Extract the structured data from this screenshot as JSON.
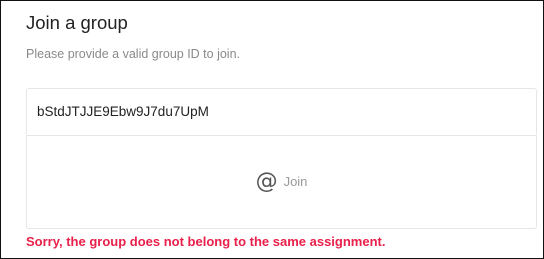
{
  "dialog": {
    "title": "Join a group",
    "subtitle": "Please provide a valid group ID to join."
  },
  "group_id_input": {
    "value": "bStdJTJJE9Ebw9J7du7UpM",
    "placeholder": ""
  },
  "join_button": {
    "icon": "at-sign-icon",
    "icon_glyph": "@",
    "label": "Join"
  },
  "error": {
    "message": "Sorry, the group does not belong to the same assignment.",
    "color": "#e8204a"
  }
}
